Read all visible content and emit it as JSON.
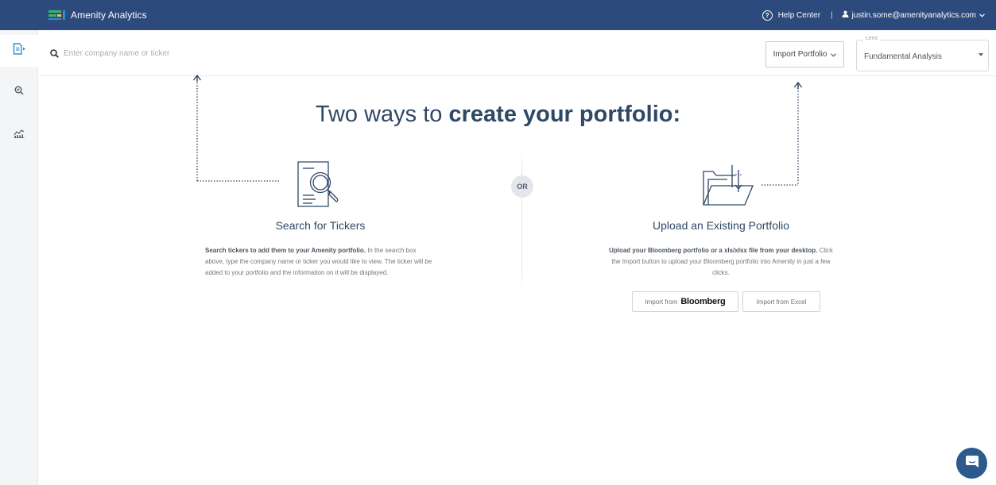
{
  "topbar": {
    "app_title": "Amenity Analytics",
    "help_label": "Help Center",
    "separator": "|",
    "user_email": "justin.some@amenityanalytics.com",
    "brand_color": "#2c4a7c",
    "logo_colors": [
      "#3db36b",
      "#2e8fd0",
      "#f2c230"
    ]
  },
  "sidebar": {
    "items": [
      {
        "icon": "document-arrow-icon",
        "active": true
      },
      {
        "icon": "search-doc-icon",
        "active": false
      },
      {
        "icon": "chart-icon",
        "active": false
      }
    ]
  },
  "search": {
    "placeholder": "Enter company name or ticker"
  },
  "toolbar": {
    "import_portfolio_label": "Import Portfolio",
    "lens_label": "Lens",
    "lens_value": "Fundamental Analysis"
  },
  "main": {
    "headline_prefix": "Two ways to ",
    "headline_bold": "create your portfolio:",
    "or_label": "OR",
    "left": {
      "title": "Search for Tickers",
      "desc_bold": "Search tickers to add them to your Amenity portfolio.",
      "desc_rest": " In the search box above, type the company name or ticker you would like to view. The ticker will be added to your portfolio and the information on it will be displayed."
    },
    "right": {
      "title": "Upload an Existing Portfolio",
      "desc_bold": "Upload your Bloomberg portfolio or a xls/xlsx file from your desktop.",
      "desc_rest": " Click the Import button to upload your Bloomberg portfolio into Amenity in just a few clicks.",
      "bloomberg_prefix": "Import from",
      "bloomberg_brand": "Bloomberg",
      "excel_label": "Import from Excel"
    }
  },
  "colors": {
    "accent": "#2e8fd0",
    "heading": "#2f4866",
    "chat": "#2c5a8c"
  }
}
